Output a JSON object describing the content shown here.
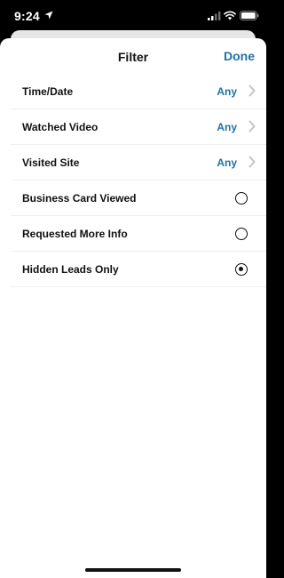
{
  "status_bar": {
    "time": "9:24",
    "icons": [
      "location-arrow-icon",
      "cellular-signal-icon",
      "wifi-icon",
      "battery-icon"
    ]
  },
  "sheet": {
    "title": "Filter",
    "done_label": "Done"
  },
  "filters": [
    {
      "label": "Time/Date",
      "value": "Any",
      "type": "disclosure"
    },
    {
      "label": "Watched Video",
      "value": "Any",
      "type": "disclosure"
    },
    {
      "label": "Visited Site",
      "value": "Any",
      "type": "disclosure"
    },
    {
      "label": "Business Card Viewed",
      "type": "radio",
      "selected": false
    },
    {
      "label": "Requested More Info",
      "type": "radio",
      "selected": false
    },
    {
      "label": "Hidden Leads Only",
      "type": "radio",
      "selected": true
    }
  ],
  "colors": {
    "accent": "#1e72a5",
    "text": "#111111",
    "background": "#ffffff",
    "status_bar": "#000000"
  }
}
